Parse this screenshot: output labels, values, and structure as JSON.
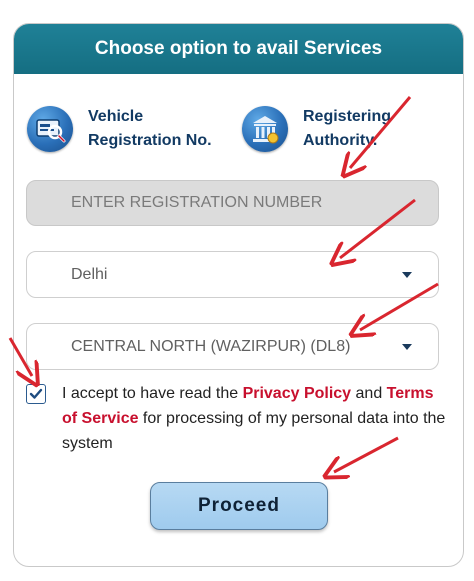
{
  "header": {
    "title": "Choose option to avail Services"
  },
  "options": [
    {
      "label": "Vehicle\nRegistration No.",
      "icon": "vehicle-search-icon"
    },
    {
      "label": "Registering\nAuthority.",
      "icon": "government-building-icon"
    }
  ],
  "registration_input": {
    "placeholder": "ENTER REGISTRATION NUMBER",
    "value": ""
  },
  "state_select": {
    "value": "Delhi"
  },
  "rto_select": {
    "value": "CENTRAL NORTH (WAZIRPUR) (DL8)"
  },
  "consent": {
    "checked": true,
    "text_before": "I accept to have read the ",
    "privacy_link": "Privacy Policy",
    "text_and": " and ",
    "terms_link": "Terms of Service",
    "text_after": " for processing of my personal data into the system"
  },
  "proceed_button": {
    "label": "Proceed"
  },
  "colors": {
    "header_bg": "#1a7a90",
    "link": "#c8102e",
    "option_label": "#123a63",
    "annotation_arrow": "#d9262f"
  }
}
